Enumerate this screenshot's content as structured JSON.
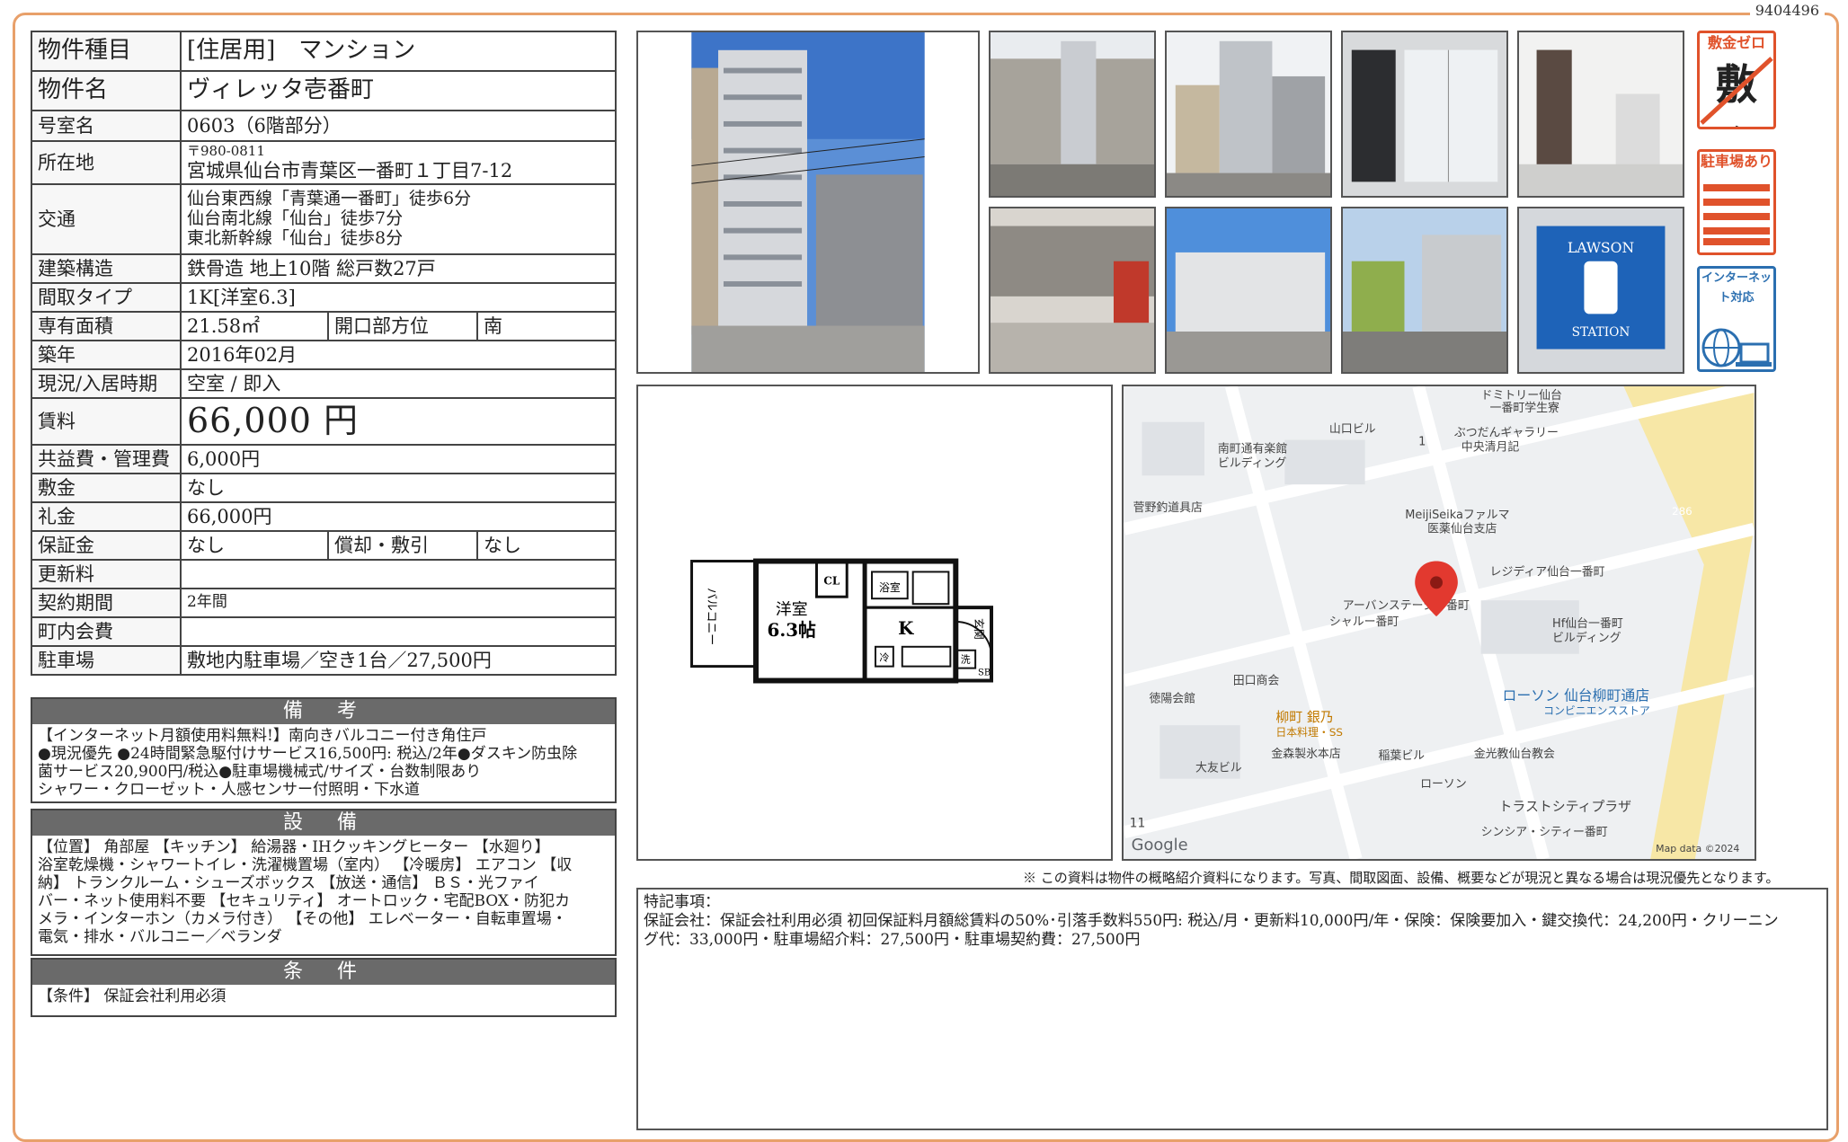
{
  "doc_id": "9404496",
  "spec": {
    "type_label": "物件種目",
    "type_value": "[住居用]　マンション",
    "name_label": "物件名",
    "name_value": "ヴィレッタ壱番町",
    "room_label": "号室名",
    "room_value": "0603（6階部分）",
    "addr_label": "所在地",
    "addr_zip": "〒980-0811",
    "addr_value": "宮城県仙台市青葉区一番町１丁目7-12",
    "traffic_label": "交通",
    "traffic_1": "仙台東西線「青葉通一番町」徒歩6分",
    "traffic_2": "仙台南北線「仙台」徒歩7分",
    "traffic_3": "東北新幹線「仙台」徒歩8分",
    "structure_label": "建築構造",
    "structure_value": "鉄骨造 地上10階 総戸数27戸",
    "layout_label": "間取タイプ",
    "layout_value": "1K[洋室6.3]",
    "area_label": "専有面積",
    "area_value": "21.58㎡",
    "facing_label": "開口部方位",
    "facing_value": "南",
    "built_label": "築年",
    "built_value": "2016年02月",
    "status_label": "現況/入居時期",
    "status_value": "空室 / 即入",
    "rent_label": "賃料",
    "rent_value": "66,000 円",
    "fee_label": "共益費・管理費",
    "fee_value": "6,000円",
    "deposit_label": "敷金",
    "deposit_value": "なし",
    "key_label": "礼金",
    "key_value": "66,000円",
    "guarantee_label": "保証金",
    "guarantee_value": "なし",
    "amort_label": "償却・敷引",
    "amort_value": "なし",
    "renew_label": "更新料",
    "renew_value": "",
    "contract_label": "契約期間",
    "contract_value": "2年間",
    "town_label": "町内会費",
    "town_value": "",
    "parking_label": "駐車場",
    "parking_value": "敷地内駐車場／空き1台／27,500円"
  },
  "remarks": {
    "title": "備　考",
    "lines": [
      "【インターネット月額使用料無料!】南向きバルコニー付き角住戸",
      "●現況優先 ●24時間緊急駆付けサービス16,500円: 税込/2年●ダスキン防虫除",
      "菌サービス20,900円/税込●駐車場機械式/サイズ・台数制限あり",
      "シャワー・クローゼット・人感センサー付照明・下水道"
    ]
  },
  "equipment": {
    "title": "設　備",
    "lines": [
      "【位置】 角部屋 【キッチン】 給湯器・IHクッキングヒーター 【水廻り】",
      "浴室乾燥機・シャワートイレ・洗濯機置場（室内） 【冷暖房】 エアコン 【収",
      "納】 トランクルーム・シューズボックス 【放送・通信】 ＢＳ・光ファイ",
      "バー・ネット使用料不要 【セキュリティ】 オートロック・宅配BOX・防犯カ",
      "メラ・インターホン（カメラ付き） 【その他】 エレベーター・自転車置場・",
      "電気・排水・バルコニー／ベランダ"
    ]
  },
  "conditions": {
    "title": "条　件",
    "text": "【条件】 保証会社利用必須"
  },
  "floorplan": {
    "room_label": "洋室",
    "room_size": "6.3帖",
    "closet": "CL",
    "bath": "浴室",
    "kitchen": "K",
    "entrance": "玄関",
    "balcony": "バルコニー",
    "fridge": "冷",
    "washer": "洗",
    "shoebox": "SB"
  },
  "map": {
    "labels": [
      "ドミトリー仙台",
      "一番町学生寮",
      "山口ビル",
      "1",
      "ぶつだんギャラリー",
      "中央清月記",
      "南町通有楽館",
      "ビルディング",
      "菅野釣道具店",
      "MeijiSeikaファルマ",
      "医薬仙台支店",
      "286",
      "レジディア仙台一番町",
      "アーバンステージ一番町",
      "シャルー番町",
      "Hf仙台一番町",
      "ビルディング",
      "徳陽会館",
      "田口商会",
      "ローソン 仙台柳町通店",
      "コンビニエンスストア",
      "柳町 銀乃",
      "日本料理・SS",
      "金森製氷本店",
      "稲葉ビル",
      "金光教仙台教会",
      "大友ビル",
      "ローソン",
      "トラストシティプラザ",
      "シンシア・シティー番町",
      "11",
      "Google",
      "Map data ©2024"
    ]
  },
  "badges": {
    "b1_top": "敷金ゼロ",
    "b1_main": "敷金",
    "b2_top": "駐車場あり",
    "b3_top": "インターネット対応"
  },
  "photos": {
    "lawson_sign_1": "LAWSON",
    "lawson_sign_2": "STATION"
  },
  "disclaimer": "※ この資料は物件の概略紹介資料になります。写真、間取図面、設備、概要などが現況と異なる場合は現況優先となります。",
  "notes": {
    "title": "特記事項：",
    "line1": "保証会社：保証会社利用必須 初回保証料月額総賃料の50%･引落手数料550円: 税込/月・更新料10,000円/年・保険：保険要加入・鍵交換代：24,200円・クリーニン",
    "line2": "グ代：33,000円・駐車場紹介料：27,500円・駐車場契約費：27,500円"
  },
  "colors": {
    "frame": "#e8a06a",
    "header_gray": "#6a6a6a",
    "badge_red": "#e0522b",
    "badge_blue": "#2b6fb0",
    "map_pin": "#e2392f"
  }
}
